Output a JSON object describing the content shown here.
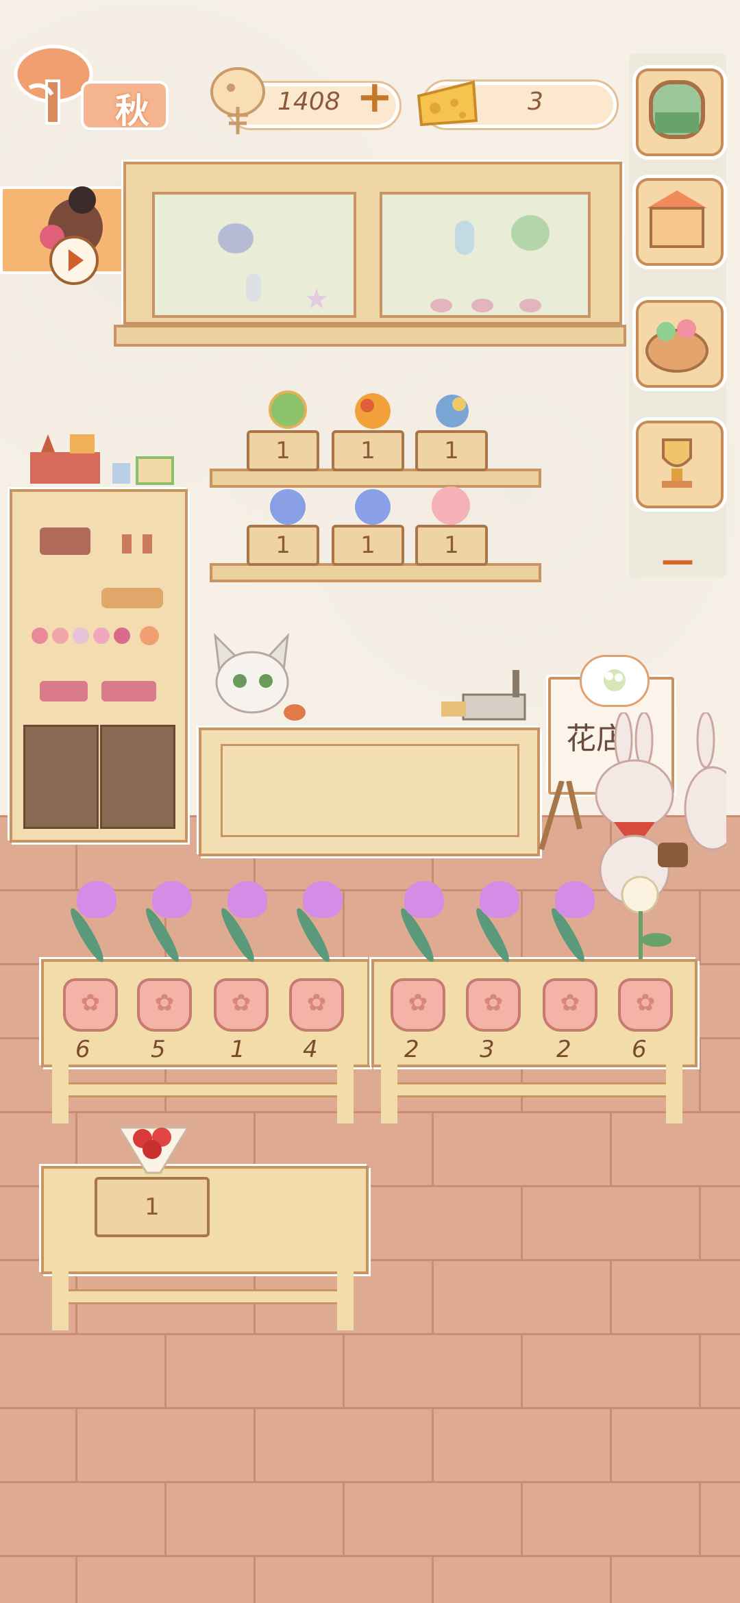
{
  "hud": {
    "season": "秋",
    "fish_coins": "1408",
    "plus": "+",
    "cheese": "3"
  },
  "colors": {
    "wall": "#f6f0e6",
    "floor": "#dfaa92",
    "wood": "#e8c98f",
    "pot": "#f3b3a7",
    "bloom": "#d38de6"
  },
  "sidebar": {
    "items": [
      {
        "icon": "window-icon"
      },
      {
        "icon": "market-stall-icon"
      },
      {
        "icon": "flower-basket-icon"
      },
      {
        "icon": "trophy-icon"
      }
    ],
    "collapse": "—"
  },
  "shelf": {
    "top_row": [
      "1",
      "1",
      "1"
    ],
    "bottom_row": [
      "1",
      "1",
      "1"
    ]
  },
  "sign": {
    "title": "花店"
  },
  "planters": {
    "left": [
      "6",
      "5",
      "1",
      "4"
    ],
    "right": [
      "2",
      "3",
      "2",
      "6"
    ]
  },
  "table": {
    "crate_count": "1"
  }
}
